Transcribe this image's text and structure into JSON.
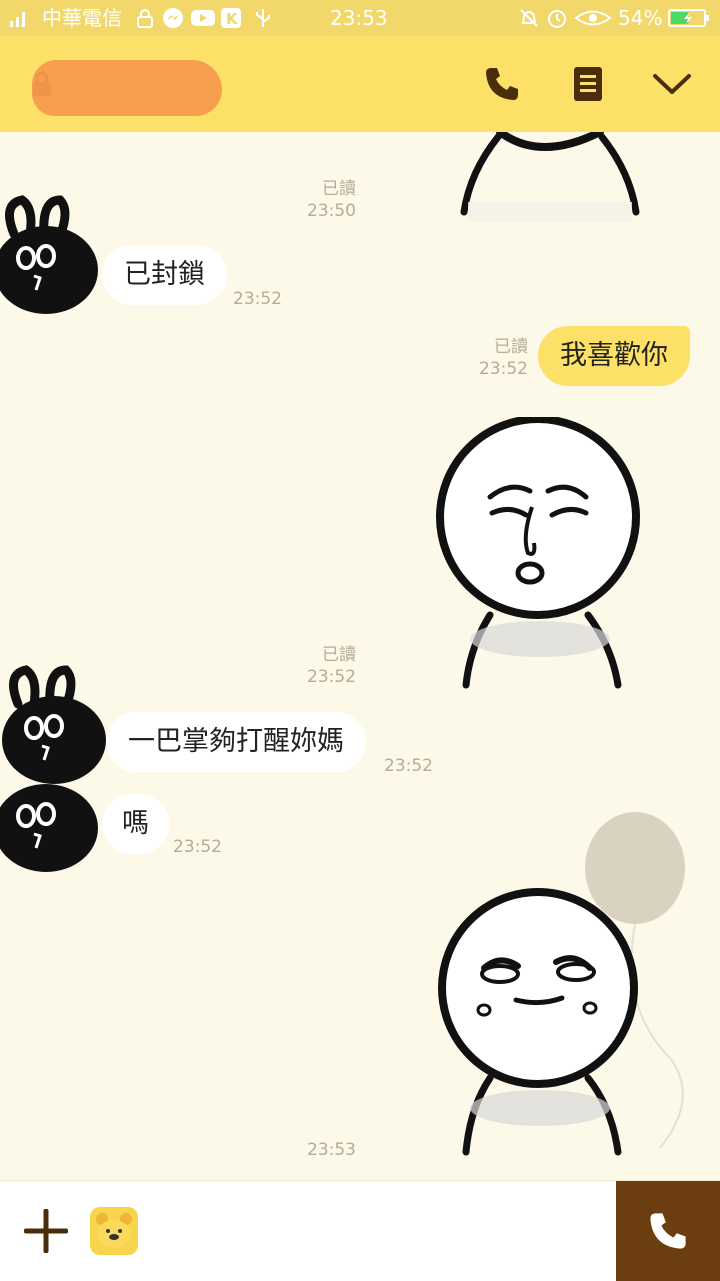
{
  "status_bar": {
    "carrier": "中華電信",
    "time": "23:53",
    "battery": "54%",
    "battery_level": 0.54,
    "icons": [
      "signal-icon",
      "lock-icon",
      "messenger-icon",
      "youtube-icon",
      "k-app-icon",
      "usb-icon",
      "mute-icon",
      "alarm-icon",
      "eye-icon",
      "battery-icon"
    ]
  },
  "header": {
    "icons": [
      "lock-icon",
      "phone-icon",
      "menu-icon",
      "chevron-down-icon"
    ]
  },
  "messages": {
    "m0_read": "已讀",
    "m0_time": "23:50",
    "m1_text": "已封鎖",
    "m1_time": "23:52",
    "m2_read": "已讀",
    "m2_time": "23:52",
    "m2_text": "我喜歡你",
    "m3_read": "已讀",
    "m3_time": "23:52",
    "m4_text": "一巴掌夠打醒妳媽",
    "m4_time": "23:52",
    "m5_text": "嗎",
    "m5_time": "23:52",
    "m6_time": "23:53"
  },
  "input_bar": {
    "icons": [
      "plus-icon",
      "emoticon-icon",
      "phone-icon"
    ]
  },
  "colors": {
    "status_bar": "#f2d86a",
    "header": "#fde067",
    "chat_bg": "#fcf9e8",
    "outgoing_bubble": "#fde067",
    "incoming_bubble": "#ffffff",
    "call_button": "#6b3d10",
    "icon_brown": "#4a2e0c"
  }
}
